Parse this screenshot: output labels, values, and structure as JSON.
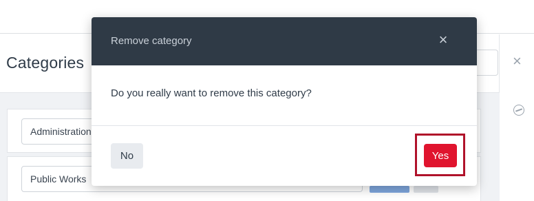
{
  "background": {
    "panel_title": "Categories",
    "categories": [
      {
        "value": "Administration"
      },
      {
        "value": "Public Works"
      }
    ],
    "close_icon": "close-icon",
    "side_icon": "circle-icon"
  },
  "modal": {
    "title": "Remove category",
    "close_icon": "×",
    "message": "Do you really want to remove this category?",
    "no_label": "No",
    "yes_label": "Yes"
  },
  "colors": {
    "modal_header": "#2f3a46",
    "danger": "#e0142e",
    "highlight": "#b0122a"
  }
}
